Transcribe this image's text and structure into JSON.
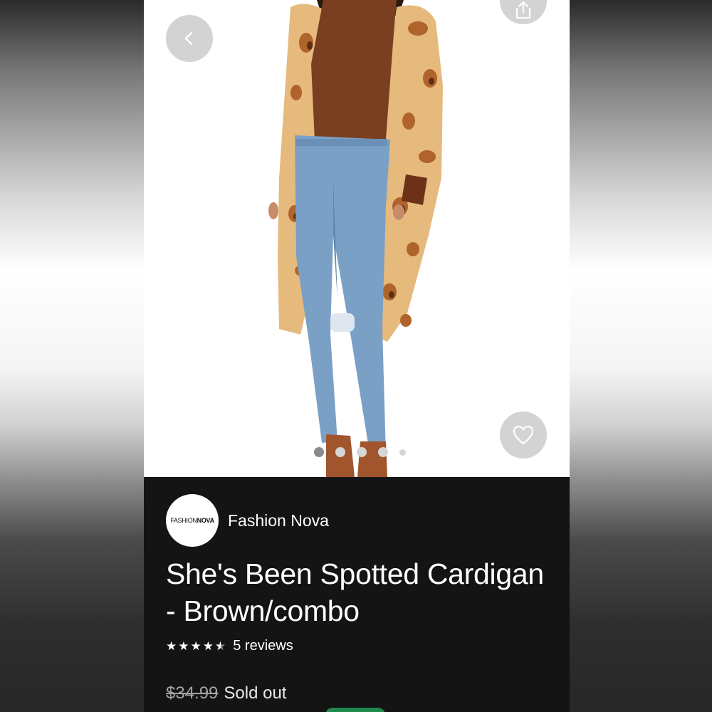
{
  "product": {
    "brand_name": "Fashion Nova",
    "brand_logo_text_light": "FASHION",
    "brand_logo_text_bold": "NOVA",
    "title": "She's Been Spotted Cardigan - Brown/combo",
    "rating": 4.5,
    "rating_max": 5,
    "reviews_label": "5 reviews",
    "original_price": "$34.99",
    "status": "Sold out"
  },
  "gallery": {
    "image_count": 5,
    "active_index": 0
  },
  "icons": {
    "back": "chevron-left-icon",
    "share": "share-icon",
    "favorite": "heart-icon"
  },
  "colors": {
    "panel_background": "#141414",
    "control_button": "#d3d3d3",
    "cta_green": "#1f8a4c"
  }
}
